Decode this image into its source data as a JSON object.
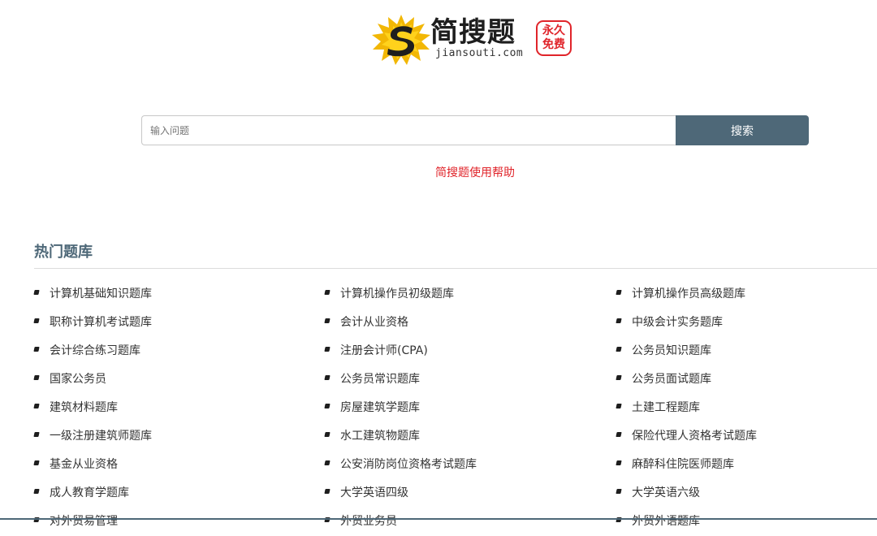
{
  "logo": {
    "title": "简搜题",
    "domain": "jiansouti.com",
    "badge_line1": "永久",
    "badge_line2": "免费"
  },
  "search": {
    "placeholder": "输入问题",
    "button_label": "搜索"
  },
  "help_link": "简搜题使用帮助",
  "hot_section": {
    "title": "热门题库",
    "items": [
      "计算机基础知识题库",
      "计算机操作员初级题库",
      "计算机操作员高级题库",
      "职称计算机考试题库",
      "会计从业资格",
      "中级会计实务题库",
      "会计综合练习题库",
      "注册会计师(CPA)",
      "公务员知识题库",
      "国家公务员",
      "公务员常识题库",
      "公务员面试题库",
      "建筑材料题库",
      "房屋建筑学题库",
      "土建工程题库",
      "一级注册建筑师题库",
      "水工建筑物题库",
      "保险代理人资格考试题库",
      "基金从业资格",
      "公安消防岗位资格考试题库",
      "麻醉科住院医师题库",
      "成人教育学题库",
      "大学英语四级",
      "大学英语六级",
      "对外贸易管理",
      "外贸业务员",
      "外贸外语题库"
    ]
  },
  "colors": {
    "accent": "#4e6878",
    "link_red": "#e0242a",
    "text": "#333333"
  }
}
